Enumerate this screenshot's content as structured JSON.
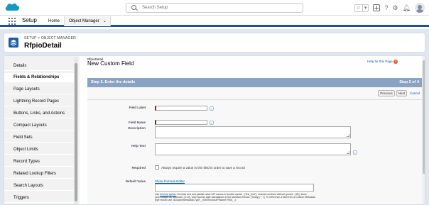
{
  "header": {
    "search_placeholder": "Search Setup",
    "icons": [
      "favorites-star-icon",
      "favorites-dropdown-icon",
      "global-add-icon",
      "help-icon",
      "setup-gear-icon",
      "notifications-bell-icon",
      "user-avatar-icon"
    ]
  },
  "nav": {
    "app_name": "Setup",
    "tabs": [
      {
        "label": "Home"
      },
      {
        "label": "Object Manager",
        "active": true
      }
    ]
  },
  "page_header": {
    "breadcrumb": "SETUP > OBJECT MANAGER",
    "title": "RfpioDetail"
  },
  "sidebar": {
    "items": [
      {
        "label": "Details"
      },
      {
        "label": "Fields & Relationships",
        "active": true
      },
      {
        "label": "Page Layouts"
      },
      {
        "label": "Lightning Record Pages"
      },
      {
        "label": "Buttons, Links, and Actions"
      },
      {
        "label": "Compact Layouts"
      },
      {
        "label": "Field Sets"
      },
      {
        "label": "Object Limits"
      },
      {
        "label": "Record Types"
      },
      {
        "label": "Related Lookup Filters"
      },
      {
        "label": "Search Layouts"
      },
      {
        "label": "Triggers"
      }
    ]
  },
  "main": {
    "object_name": "RfpioDetail",
    "title": "New Custom Field",
    "help_link": "Help for this Page",
    "step_title": "Step 2. Enter the details",
    "step_count": "Step 2 of 4",
    "buttons": {
      "previous": "Previous",
      "next": "Next",
      "cancel": "Cancel"
    },
    "fields": {
      "field_label": {
        "label": "Field Label",
        "value": ""
      },
      "field_name": {
        "label": "Field Name",
        "value": ""
      },
      "description": {
        "label": "Description",
        "value": ""
      },
      "help_text": {
        "label": "Help Text",
        "value": ""
      },
      "required": {
        "label": "Required",
        "text": "Always require a value in this field in order to save a record",
        "checked": false
      },
      "default_value": {
        "label": "Default Value",
        "link": "Show Formula Editor",
        "value": ""
      }
    },
    "hint": {
      "prefix": "Use ",
      "link": "formula syntax",
      "text": ": Enclose text and picklist value API names in double quotes : (\"the_text\"), include numbers without quotes : (25), show percentages as decimals: (0.10), and express date calculations in the standard format: (Today() + 7). To reference a field from a Custom Metadata type record use: $CustomMetadata.Type__mdt.RecordAPIName.Field__c"
    }
  },
  "colors": {
    "nav_underline": "#1b5297",
    "page_bg": "#dfe6ef",
    "step_header": "#8aa3c2",
    "required_marker": "#cc0000",
    "link": "#015ba7"
  }
}
